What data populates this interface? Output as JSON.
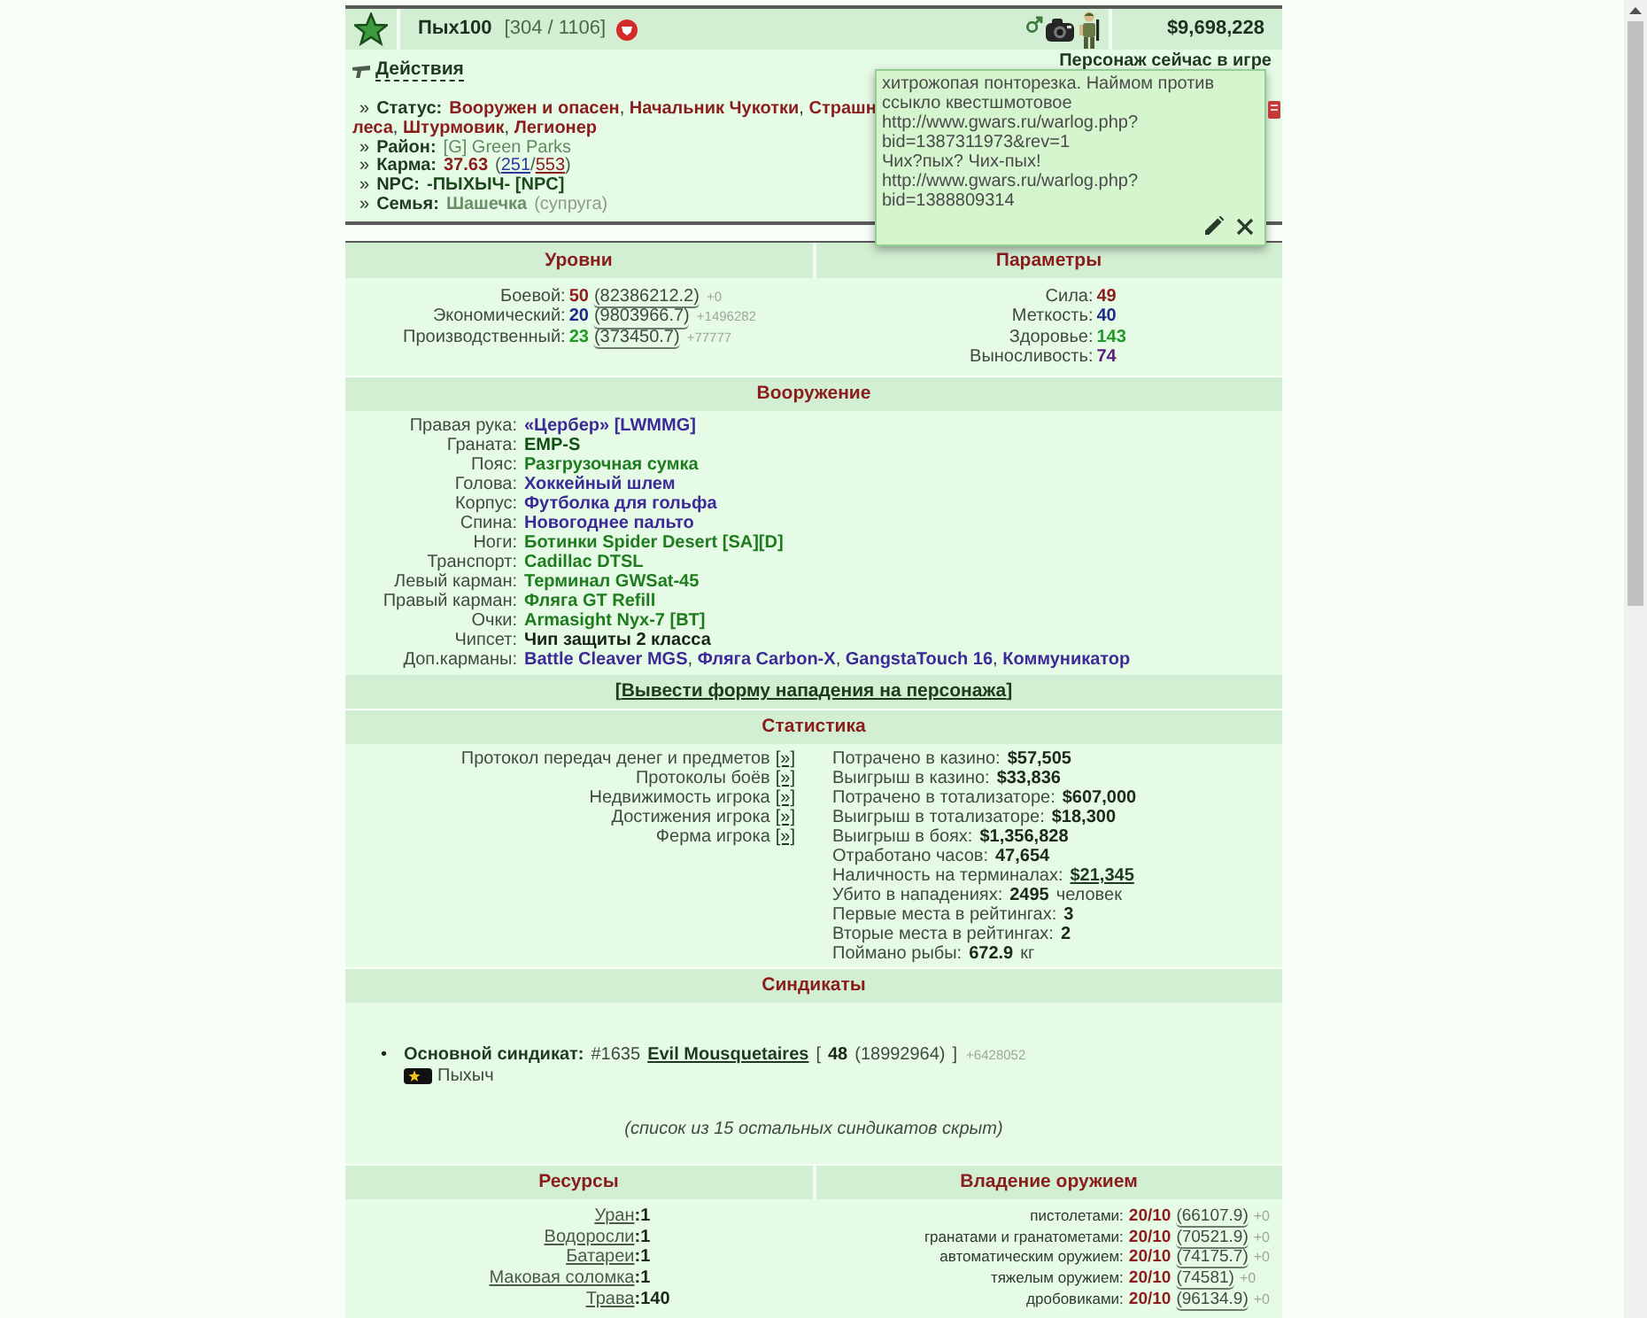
{
  "header": {
    "name": "Пых100",
    "hp": "[304 / 1106]",
    "money": "$9,698,228"
  },
  "profile": {
    "actions": "Действия",
    "presence": "Персонаж сейчас в игре",
    "info": [
      {
        "lines": [
          [
            {
              "kind": "bullet",
              "text": "»"
            },
            {
              "kind": "label",
              "text": "Статус:"
            },
            {
              "kind": "title",
              "text": "Вооружен и опасен"
            },
            {
              "kind": "sep",
              "text": ", "
            },
            {
              "kind": "title",
              "text": "Начальник Чукотки"
            },
            {
              "kind": "sep",
              "text": ", "
            },
            {
              "kind": "title",
              "text": "Страшн"
            }
          ],
          [
            {
              "kind": "title",
              "text": "леса"
            },
            {
              "kind": "sep",
              "text": ", "
            },
            {
              "kind": "title",
              "text": "Штурмовик"
            },
            {
              "kind": "sep",
              "text": ", "
            },
            {
              "kind": "title",
              "text": "Легионер"
            }
          ]
        ]
      },
      {
        "lines": [
          [
            {
              "kind": "bullet",
              "text": "»"
            },
            {
              "kind": "label",
              "text": "Район:"
            },
            {
              "kind": "district",
              "text": "[G] Green Parks"
            }
          ]
        ]
      },
      {
        "lines": [
          [
            {
              "kind": "bullet",
              "text": "»"
            },
            {
              "kind": "label",
              "text": "Карма:"
            },
            {
              "kind": "value",
              "text": "37.63"
            },
            {
              "kind": "paren",
              "text": "("
            },
            {
              "kind": "up",
              "text": "251"
            },
            {
              "kind": "paren",
              "text": "/"
            },
            {
              "kind": "down",
              "text": "553"
            },
            {
              "kind": "paren",
              "text": ")"
            }
          ]
        ]
      },
      {
        "lines": [
          [
            {
              "kind": "bullet",
              "text": "»"
            },
            {
              "kind": "label",
              "text": "NPC:"
            },
            {
              "kind": "npc",
              "text": "-ПЫХЫЧ- [NPC]"
            }
          ]
        ]
      },
      {
        "lines": [
          [
            {
              "kind": "bullet",
              "text": "»"
            },
            {
              "kind": "label",
              "text": "Семья:"
            },
            {
              "kind": "spouse",
              "text": "Шашечка"
            },
            {
              "kind": "note",
              "text": "(супруга)"
            }
          ]
        ]
      }
    ]
  },
  "note_popup": {
    "lines": [
      "хитрожопая понторезка. Наймом против",
      "ссыкло квестшмотовое",
      "http://www.gwars.ru/warlog.php?",
      "bid=1387311973&rev=1",
      "Чих?пых? Чих-пых!",
      "http://www.gwars.ru/warlog.php?",
      "bid=1388809314"
    ]
  },
  "levels": {
    "title": "Уровни",
    "rows": [
      {
        "label": "Боевой:",
        "value": "50",
        "color": "#8b1c1c",
        "exp": "(82386212.2)",
        "delta": "+0"
      },
      {
        "label": "Экономический:",
        "value": "20",
        "color": "#1c2a8a",
        "exp": "(9803966.7)",
        "delta": "+1496282"
      },
      {
        "label": "Производственный:",
        "value": "23",
        "color": "#22992a",
        "exp": "(373450.7)",
        "delta": "+77777"
      }
    ]
  },
  "params": {
    "title": "Параметры",
    "rows": [
      {
        "label": "Сила:",
        "value": "49",
        "color": "#8b1c1c"
      },
      {
        "label": "Меткость:",
        "value": "40",
        "color": "#1c2a8a"
      },
      {
        "label": "Здоровье:",
        "value": "143",
        "color": "#22992a"
      },
      {
        "label": "Выносливость:",
        "value": "74",
        "color": "#5a1c7a"
      }
    ]
  },
  "equipment": {
    "title": "Вооружение",
    "separator": ", ",
    "rows": [
      {
        "slot": "Правая рука:",
        "items": [
          {
            "text": "«Цербер» [LWMMG]",
            "color": "#3b2a98"
          }
        ]
      },
      {
        "slot": "Граната:",
        "items": [
          {
            "text": "EMP-S",
            "color": "#0f4f0f"
          }
        ]
      },
      {
        "slot": "Пояс:",
        "items": [
          {
            "text": "Разгрузочная сумка",
            "color": "#1e7b1e"
          }
        ]
      },
      {
        "slot": "Голова:",
        "items": [
          {
            "text": "Хоккейный шлем",
            "color": "#3b2a98"
          }
        ]
      },
      {
        "slot": "Корпус:",
        "items": [
          {
            "text": "Футболка для гольфа",
            "color": "#3b2a98"
          }
        ]
      },
      {
        "slot": "Спина:",
        "items": [
          {
            "text": "Новогоднее пальто",
            "color": "#3b2a98"
          }
        ]
      },
      {
        "slot": "Ноги:",
        "items": [
          {
            "text": "Ботинки Spider Desert [SA][D]",
            "color": "#1e7b1e"
          }
        ]
      },
      {
        "slot": "Транспорт:",
        "items": [
          {
            "text": "Cadillac DTSL",
            "color": "#1e7b1e"
          }
        ]
      },
      {
        "slot": "Левый карман:",
        "items": [
          {
            "text": "Терминал GWSat-45",
            "color": "#1e7b1e"
          }
        ]
      },
      {
        "slot": "Правый карман:",
        "items": [
          {
            "text": "Фляга GT Refill",
            "color": "#1e7b1e"
          }
        ]
      },
      {
        "slot": "Очки:",
        "items": [
          {
            "text": "Armasight Nyx-7 [BT]",
            "color": "#1e7b1e"
          }
        ]
      },
      {
        "slot": "Чипсет:",
        "items": [
          {
            "text": "Чип защиты 2 класса",
            "color": "#142414"
          }
        ]
      },
      {
        "slot": "Доп.карманы:",
        "items": [
          {
            "text": "Battle Cleaver MGS",
            "color": "#3b2a98"
          },
          {
            "text": "Фляга Carbon-X",
            "color": "#3b2a98"
          },
          {
            "text": "GangstaTouch 16",
            "color": "#3b2a98"
          },
          {
            "text": "Коммуникатор",
            "color": "#3b2a98"
          }
        ]
      }
    ]
  },
  "attack_link": {
    "open": "[",
    "text": "Вывести форму нападения на персонажа",
    "close": "]"
  },
  "stats": {
    "title": "Статистика",
    "links": [
      {
        "label": "Протокол передач денег и предметов",
        "link": "[»]"
      },
      {
        "label": "Протоколы боёв",
        "link": "[»]"
      },
      {
        "label": "Недвижимость игрока",
        "link": "[»]"
      },
      {
        "label": "Достижения игрока",
        "link": "[»]"
      },
      {
        "label": "Ферма игрока",
        "link": "[»]"
      }
    ],
    "rows": [
      {
        "label": "Потрачено в казино:",
        "value": "$57,505",
        "kind": "plain"
      },
      {
        "label": "Выигрыш в казино:",
        "value": "$33,836",
        "kind": "plain"
      },
      {
        "label": "Потрачено в тотализаторе:",
        "value": "$607,000",
        "kind": "plain"
      },
      {
        "label": "Выигрыш в тотализаторе:",
        "value": "$18,300",
        "kind": "plain"
      },
      {
        "label": "Выигрыш в боях:",
        "value": "$1,356,828",
        "kind": "plain"
      },
      {
        "label": "Отработано часов:",
        "value": "47,654",
        "kind": "plain"
      },
      {
        "label": "Наличность на терминалах:",
        "value": "$21,345",
        "kind": "link"
      },
      {
        "label": "Убито в нападениях:",
        "value": "2495",
        "unit": "человек",
        "kind": "plain"
      },
      {
        "label": "Первые места в рейтингах:",
        "value": "3",
        "kind": "plain"
      },
      {
        "label": "Вторые места в рейтингах:",
        "value": "2",
        "kind": "plain"
      },
      {
        "label": "Поймано рыбы:",
        "value": "672.9",
        "unit": "кг",
        "kind": "plain"
      }
    ]
  },
  "syndicates": {
    "title": "Синдикаты",
    "main": {
      "bullet": "•",
      "label": "Основной синдикат:",
      "number": "#1635",
      "name": "Evil Mousquetaires",
      "open": "[",
      "points": "48",
      "exp": "(18992964)",
      "close": "]",
      "delta": "+6428052"
    },
    "member": {
      "name": "Пыхыч"
    },
    "hidden_note": "(список из 15 остальных синдикатов скрыт)"
  },
  "resources": {
    "title": "Ресурсы",
    "rows": [
      {
        "name": "Уран",
        "value": ":1"
      },
      {
        "name": "Водоросли",
        "value": ":1"
      },
      {
        "name": "Батареи",
        "value": ":1"
      },
      {
        "name": "Маковая соломка",
        "value": ":1"
      },
      {
        "name": "Трава",
        "value": ":140"
      }
    ]
  },
  "weapon_skills": {
    "title": "Владение оружием",
    "rows": [
      {
        "label": "пистолетами:",
        "value": "20/10",
        "exp": "(66107.9)",
        "delta": "+0"
      },
      {
        "label": "гранатами и гранатометами:",
        "value": "20/10",
        "exp": "(70521.9)",
        "delta": "+0"
      },
      {
        "label": "автоматическим оружием:",
        "value": "20/10",
        "exp": "(74175.7)",
        "delta": "+0"
      },
      {
        "label": "тяжелым оружием:",
        "value": "20/10",
        "exp": "(74581)",
        "delta": "+0"
      },
      {
        "label": "дробовиками:",
        "value": "20/10",
        "exp": "(96134.9)",
        "delta": "+0"
      }
    ]
  }
}
